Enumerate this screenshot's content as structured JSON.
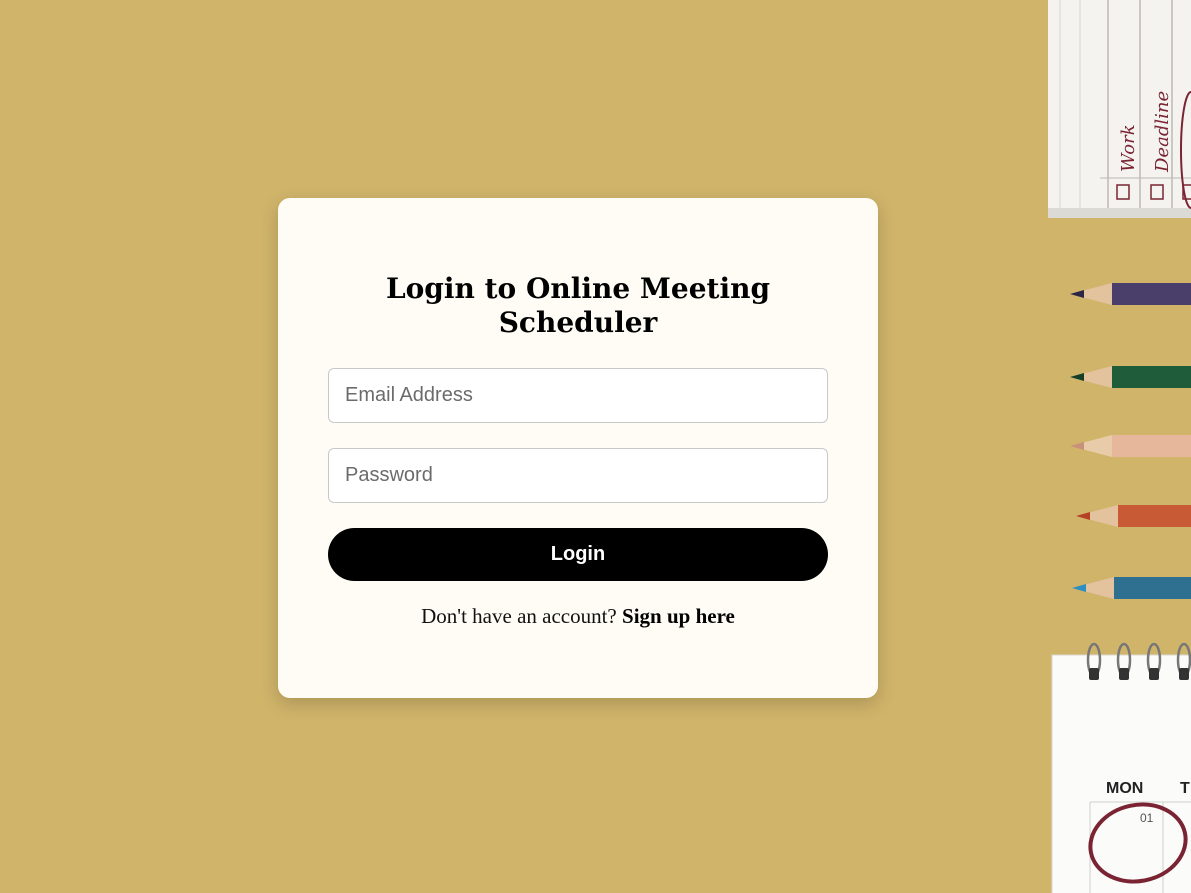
{
  "login": {
    "title": "Login to Online Meeting Scheduler",
    "email_placeholder": "Email Address",
    "password_placeholder": "Password",
    "button_label": "Login",
    "signup_prompt": "Don't have an account?",
    "signup_link": "Sign up here"
  },
  "notepad": {
    "items": [
      "Work",
      "Deadline"
    ]
  },
  "calendar": {
    "day_header": "MON",
    "next_day_header": "T",
    "date": "01"
  },
  "colors": {
    "background": "#d0b46a",
    "card": "#fefcf5",
    "button": "#000000",
    "pencils": [
      "#4a3f6b",
      "#1f5c3a",
      "#e6b79a",
      "#c85a35",
      "#2f6f8f"
    ]
  }
}
